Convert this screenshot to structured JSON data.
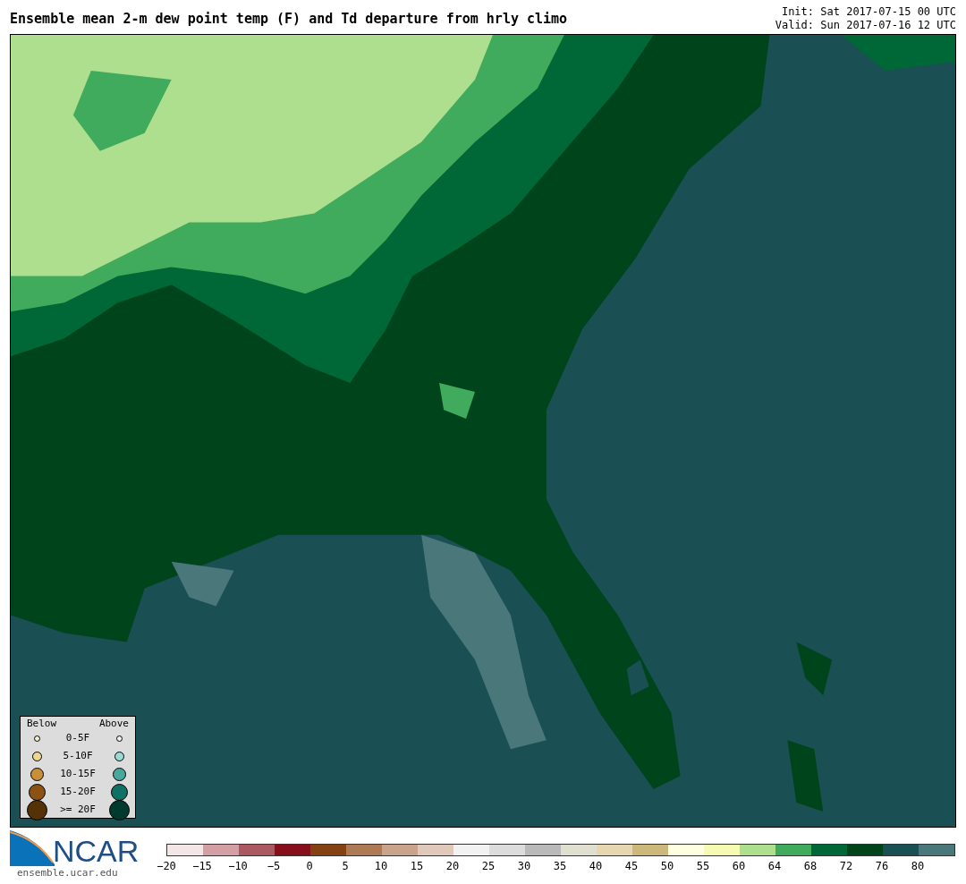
{
  "title": "Ensemble mean 2-m dew point temp (F) and Td departure from hrly climo",
  "init": "Init: Sat 2017-07-15 00 UTC",
  "valid": "Valid: Sun 2017-07-16 12 UTC",
  "legend": {
    "below": "Below",
    "above": "Above",
    "rows": [
      {
        "label": "0-5F",
        "below": {
          "color": "#f3ecd0"
        },
        "above": {
          "color": "#eef2f2"
        }
      },
      {
        "label": "5-10F",
        "below": {
          "color": "#f0d590"
        },
        "above": {
          "color": "#99dbd1"
        }
      },
      {
        "label": "10-15F",
        "below": {
          "color": "#c88f3a"
        },
        "above": {
          "color": "#49a79c"
        }
      },
      {
        "label": "15-20F",
        "below": {
          "color": "#8c5211"
        },
        "above": {
          "color": "#0e7166"
        }
      },
      {
        "label": ">= 20F",
        "below": {
          "color": "#553107"
        },
        "above": {
          "color": "#00392d"
        }
      }
    ]
  },
  "logo": {
    "name": "NCAR",
    "url": "ensemble.ucar.edu"
  },
  "colorbar": {
    "segments": [
      {
        "color": "#f4e6e7"
      },
      {
        "color": "#d39fa5"
      },
      {
        "color": "#ac5860"
      },
      {
        "color": "#870f1c"
      },
      {
        "color": "#844112"
      },
      {
        "color": "#ae7a55"
      },
      {
        "color": "#c9a38b"
      },
      {
        "color": "#e0c8ba"
      },
      {
        "color": "#f2f2f2"
      },
      {
        "color": "#dcdcdc"
      },
      {
        "color": "#b9b9b9"
      },
      {
        "color": "#e0e0d0"
      },
      {
        "color": "#e6d7b0"
      },
      {
        "color": "#cdb87c"
      },
      {
        "color": "#fefee0"
      },
      {
        "color": "#f5fbb0"
      },
      {
        "color": "#addf8e"
      },
      {
        "color": "#41ab5d"
      },
      {
        "color": "#006837"
      },
      {
        "color": "#00441b"
      },
      {
        "color": "#1a4f54"
      },
      {
        "color": "#4a777a"
      }
    ],
    "ticks": [
      "−20",
      "−15",
      "−10",
      "−5",
      "0",
      "5",
      "10",
      "15",
      "20",
      "25",
      "30",
      "35",
      "40",
      "45",
      "50",
      "55",
      "60",
      "64",
      "68",
      "72",
      "76",
      "80"
    ]
  }
}
